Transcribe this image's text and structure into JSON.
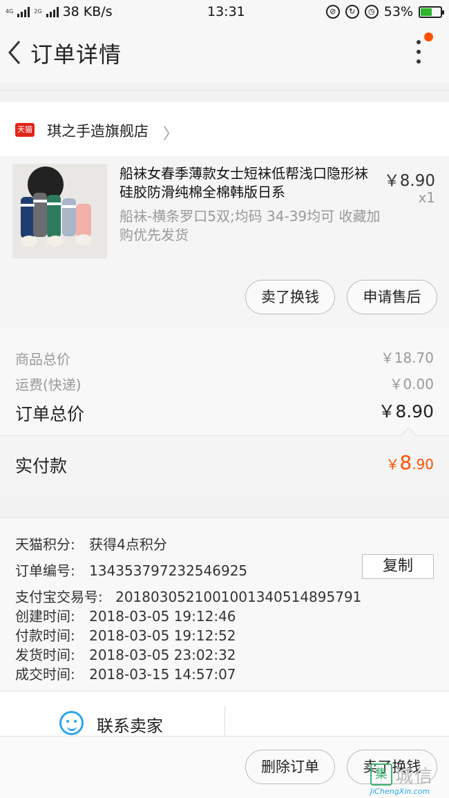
{
  "status_bar": {
    "network_type": "4G",
    "network_type_2": "2G",
    "speed": "38 KB/s",
    "time": "13:31",
    "battery": "53%"
  },
  "nav": {
    "title": "订单详情"
  },
  "shop": {
    "badge": "天猫",
    "name": "琪之手造旗舰店"
  },
  "item": {
    "title": "船袜女春季薄款女士短袜低帮浅口隐形袜硅胶防滑纯棉全棉韩版日系",
    "price": "￥8.90",
    "quantity": "x1",
    "sku": "船袜-横条罗口5双;均码 34-39均可 收藏加购优先发货",
    "sell_button": "卖了换钱",
    "after_sale_button": "申请售后"
  },
  "summary": {
    "goods_total_label": "商品总价",
    "goods_total_value": "￥18.70",
    "shipping_label": "运费(快递)",
    "shipping_value": "￥0.00",
    "order_total_label": "订单总价",
    "order_total_value": "￥8.90"
  },
  "paid": {
    "label": "实付款",
    "currency": "￥",
    "integer": "8",
    "decimal": ".90"
  },
  "info": {
    "points_label": "天猫积分:",
    "points_value": "获得4点积分",
    "order_no_label": "订单编号:",
    "order_no_value": "1343537972325469​25",
    "copy_button": "复制",
    "alipay_label": "支付宝交易号:",
    "alipay_value": "2018030521001001340514895791",
    "created_label": "创建时间:",
    "created_value": "2018-03-05 19:12:46",
    "paid_label": "付款时间:",
    "paid_value": "2018-03-05 19:12:52",
    "shipped_label": "发货时间:",
    "shipped_value": "2018-03-05 23:02:32",
    "completed_label": "成交时间:",
    "completed_value": "2018-03-15 14:57:07"
  },
  "contact": {
    "label": "联系卖家"
  },
  "bottom": {
    "delete_button": "删除订单",
    "sell_button": "卖了换钱"
  },
  "watermark": {
    "mark": "集",
    "cn": "城信",
    "en": "JiChengXin.com"
  },
  "colors": {
    "accent": "#ff5000",
    "tmall_red": "#e1251b",
    "contact_blue": "#2aa6e8"
  }
}
